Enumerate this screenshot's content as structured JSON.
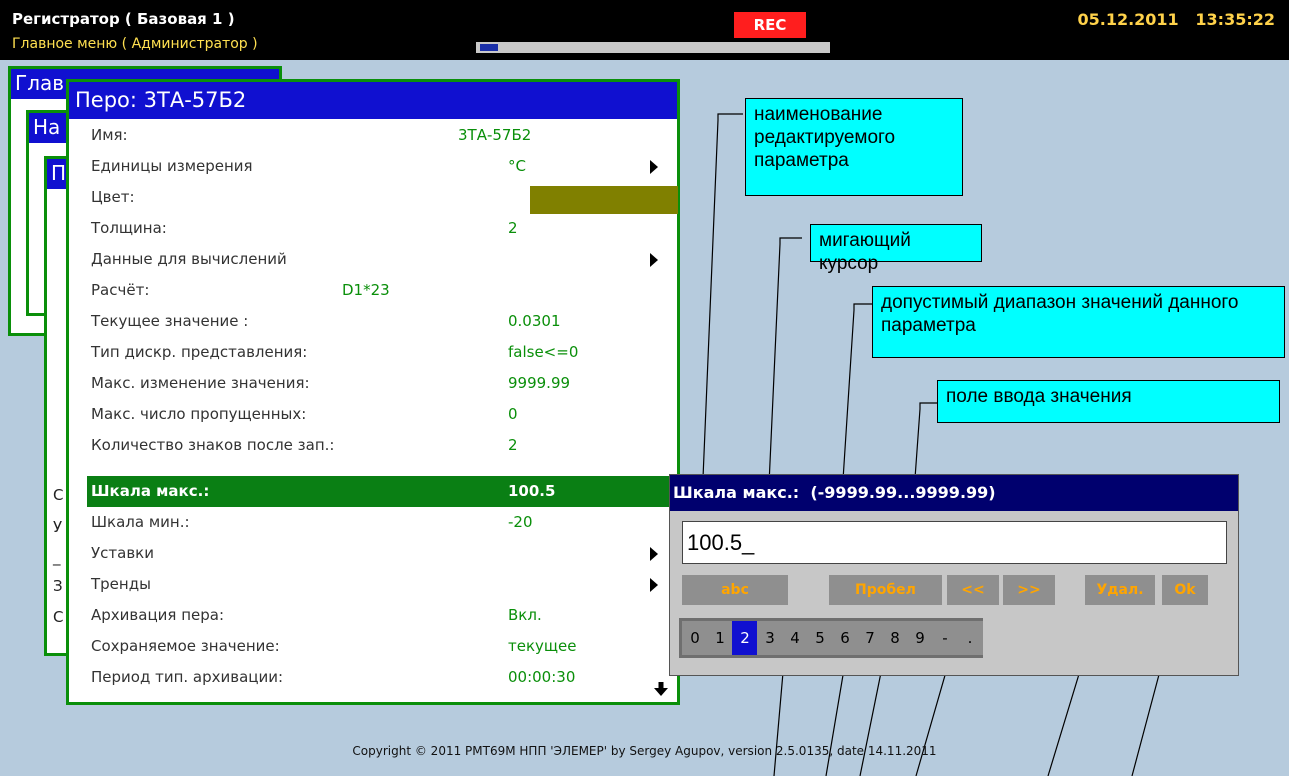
{
  "header": {
    "title": "Регистратор ( Базовая 1 )",
    "subtitle": "Главное меню ( Администратор )",
    "rec_label": "REC",
    "date": "05.12.2011",
    "time": "13:35:22"
  },
  "background_windows": {
    "win1_title": "Глав",
    "win2_title": "На",
    "win3_title": "П",
    "rows": [
      "С",
      "У",
      "_",
      "З",
      "С"
    ]
  },
  "pen_window": {
    "title": "Перо: 3ТА-57Б2",
    "rows": [
      {
        "label": "Имя:",
        "value": "3ТА-57Б2"
      },
      {
        "label": "Единицы измерения",
        "value": "°С"
      },
      {
        "label": "Цвет:",
        "value": ""
      },
      {
        "label": "Толщина:",
        "value": "2"
      },
      {
        "label": "Данные для вычислений",
        "value": ""
      },
      {
        "label": "Расчёт:",
        "value": "D1*23"
      },
      {
        "label": "Текущее значение :",
        "value": "0.0301"
      },
      {
        "label": "Тип дискр. представления:",
        "value": "false<=0"
      },
      {
        "label": "Макс. изменение значения:",
        "value": "9999.99"
      },
      {
        "label": "Макс. число пропущенных:",
        "value": "0"
      },
      {
        "label": "Количество знаков после зап.:",
        "value": "2"
      },
      {
        "label": "Шкала макс.:",
        "value": "100.5"
      },
      {
        "label": "Шкала мин.:",
        "value": "-20"
      },
      {
        "label": "Уставки",
        "value": ""
      },
      {
        "label": "Тренды",
        "value": ""
      },
      {
        "label": "Архивация пера:",
        "value": "Вкл."
      },
      {
        "label": "Сохраняемое значение:",
        "value": "текущее"
      },
      {
        "label": "Период тип. архивации:",
        "value": "00:00:30"
      }
    ],
    "color_swatch": "#808000"
  },
  "edit_dialog": {
    "title": "Шкала макс.:  (-9999.99...9999.99)",
    "input_value": "100.5_",
    "buttons": [
      "abc",
      "Пробел",
      "<<",
      ">>",
      "Удал.",
      "Ok"
    ],
    "digits": [
      "0",
      "1",
      "2",
      "3",
      "4",
      "5",
      "6",
      "7",
      "8",
      "9",
      "-",
      "."
    ],
    "selected_digit": "2"
  },
  "annotations": {
    "param_name": "наименование редактируемого параметра",
    "cursor": "мигающий курсор",
    "range": "допустимый диапазон значений данного параметра",
    "input_field": "поле ввода значения"
  },
  "footer": {
    "copyright": "Copyright © 2011 РМТ69М НПП 'ЭЛЕМЕР' by Sergey Agupov, version 2.5.0135, date 14.11.2011"
  },
  "status_progress": 0.05,
  "colors": {
    "desktop": "#b6cbdd",
    "title_blue": "#1010d0",
    "accent_green": "#0a8f0a",
    "rec_red": "#ff1e1e",
    "callout_cyan": "#00ffff"
  }
}
